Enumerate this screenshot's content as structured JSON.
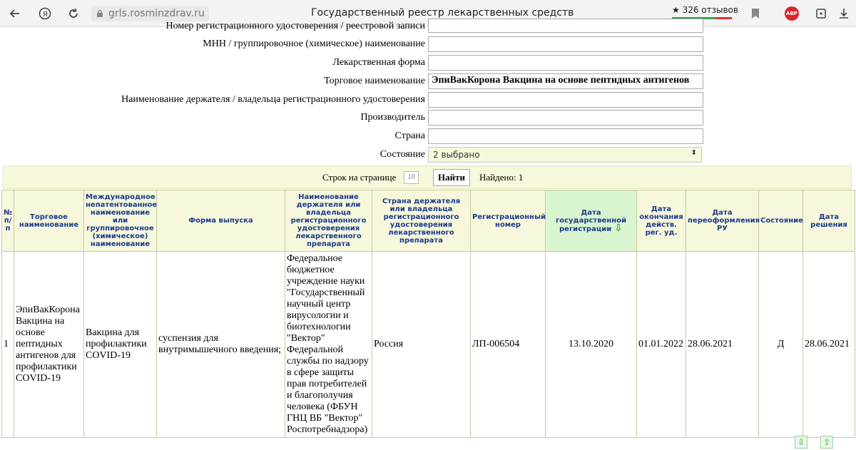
{
  "browser": {
    "url": "grls.rosminzdrav.ru",
    "title": "Государственный реестр лекарственных средств",
    "reviews": "★ 326 отзывов",
    "abp": "ABP"
  },
  "form": {
    "rows": [
      {
        "label": "Номер регистрационного удостоверения / реестровой записи",
        "value": ""
      },
      {
        "label": "МНН / группировочное (химическое) наименование",
        "value": ""
      },
      {
        "label": "Лекарственная форма",
        "value": ""
      },
      {
        "label": "Торговое наименование",
        "value": "ЭпиВакКорона Вакцина на основе пептидных антигенов"
      },
      {
        "label": "Наименование держателя / владельца регистрационного удостоверения",
        "value": ""
      },
      {
        "label": "Производитель",
        "value": ""
      },
      {
        "label": "Страна",
        "value": ""
      }
    ],
    "status_label": "Состояние",
    "status_value": "2 выбрано"
  },
  "toolbar": {
    "rows_label": "Строк на странице",
    "rows_value": "10",
    "find_label": "Найти",
    "found_label": "Найдено: 1"
  },
  "table": {
    "headers": [
      "№ п/п",
      "Торговое наименование",
      "Международное непатентованное наименование или группировочное (химическое) наименование",
      "Форма выпуска",
      "Наименование держателя или владельца регистрационного удостоверения лекарственного препарата",
      "Страна держателя или владельца регистрационного удостоверения лекарственного препарата",
      "Регистрационный номер",
      "Дата государственной регистрации",
      "Дата окончания действ. рег. уд.",
      "Дата переоформления РУ",
      "Состояние",
      "Дата решения"
    ],
    "rows": [
      [
        "1",
        "ЭпиВакКорона Вакцина на основе пептидных антигенов для профилактики COVID-19",
        "Вакцина для профилактики COVID-19",
        "суспензия для внутримышечного введения;",
        "Федеральное бюджетное учреждение науки \"Государственный научный центр вирусологии и биотехнологии \"Вектор\" Федеральной службы по надзору в сфере защиты прав потребителей и благополучия человека (ФБУН ГНЦ ВБ \"Вектор\" Роспотребнадзора)",
        "Россия",
        "ЛП-006504",
        "13.10.2020",
        "01.01.2022",
        "28.06.2021",
        "Д",
        "28.06.2021"
      ]
    ]
  }
}
